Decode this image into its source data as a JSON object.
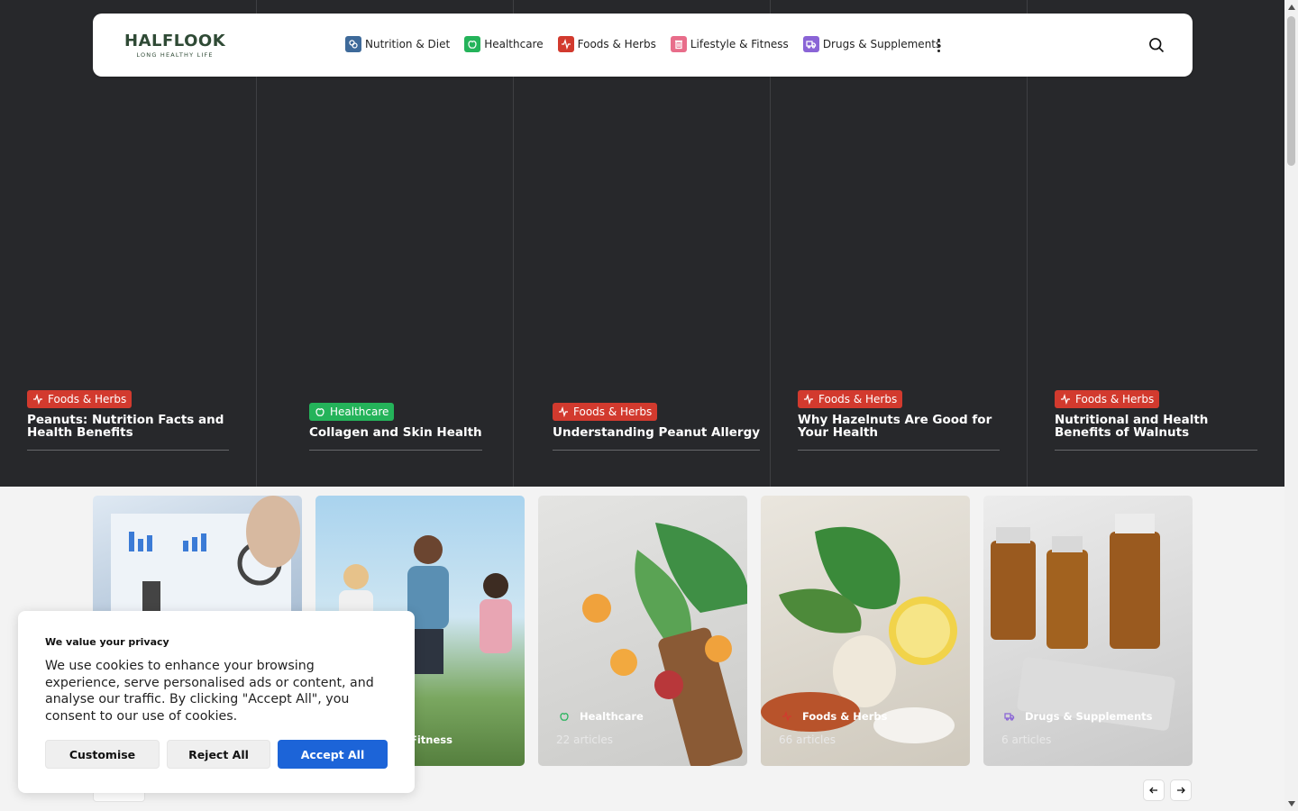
{
  "header": {
    "logo_main": "HALFLOOK",
    "logo_sub": "LONG HEALTHY LIFE",
    "nav": [
      {
        "label": "Nutrition & Diet",
        "icon": "pills-icon",
        "color": "#3e6a9a"
      },
      {
        "label": "Healthcare",
        "icon": "apple-icon",
        "color": "#24b35a"
      },
      {
        "label": "Foods & Herbs",
        "icon": "pulse-icon",
        "color": "#d23a2e"
      },
      {
        "label": "Lifestyle & Fitness",
        "icon": "trash-icon",
        "color": "#e86d8a"
      },
      {
        "label": "Drugs & Supplements",
        "icon": "truck-icon",
        "color": "#8a64d6"
      }
    ]
  },
  "hero": [
    {
      "category": "Foods & Herbs",
      "color": "#d23a2e",
      "title": "Peanuts: Nutrition Facts and Health Benefits"
    },
    {
      "category": "Healthcare",
      "color": "#24b35a",
      "title": "Collagen and Skin Health"
    },
    {
      "category": "Foods & Herbs",
      "color": "#d23a2e",
      "title": "Understanding Peanut Allergy"
    },
    {
      "category": "Foods & Herbs",
      "color": "#d23a2e",
      "title": "Why Hazelnuts Are Good for Your Health"
    },
    {
      "category": "Foods & Herbs",
      "color": "#d23a2e",
      "title": "Nutritional and Health Benefits of Walnuts"
    }
  ],
  "categories": [
    {
      "name": "",
      "count": ""
    },
    {
      "name": "Fitness",
      "count": ""
    },
    {
      "name": "Healthcare",
      "count": "22 articles"
    },
    {
      "name": "Foods & Herbs",
      "count": "66 articles"
    },
    {
      "name": "Drugs & Supplements",
      "count": "6 articles"
    }
  ],
  "cookie": {
    "title": "We value your privacy",
    "text": "We use cookies to enhance your browsing experience, serve personalised ads or content, and analyse our traffic. By clicking \"Accept All\", you consent to our use of cookies.",
    "customise": "Customise",
    "reject": "Reject All",
    "accept": "Accept All"
  }
}
